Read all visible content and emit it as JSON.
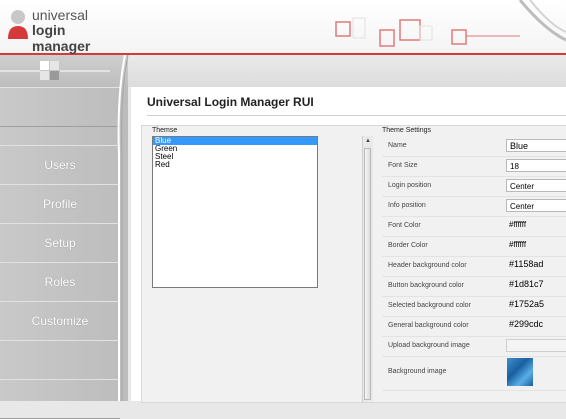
{
  "brand": {
    "line1": "universal",
    "line2": "login manager"
  },
  "sidebar": {
    "items": [
      {
        "label": ""
      },
      {
        "label": "Users"
      },
      {
        "label": "Profile"
      },
      {
        "label": "Setup"
      },
      {
        "label": "Roles"
      },
      {
        "label": "Customize"
      },
      {
        "label": ""
      },
      {
        "label": ""
      }
    ]
  },
  "page": {
    "title": "Universal Login Manager RUI"
  },
  "themes": {
    "caption": "Themse",
    "options": [
      "Blue",
      "Green",
      "Steel",
      "Red"
    ],
    "selected": "Blue"
  },
  "settings": {
    "caption": "Theme Settings",
    "rows": [
      {
        "label": "Name",
        "value": "Blue"
      },
      {
        "label": "Font Size",
        "value": "18"
      },
      {
        "label": "Login position",
        "value": "Center"
      },
      {
        "label": "Info position",
        "value": "Center"
      },
      {
        "label": "Font Color",
        "value": "#ffffff"
      },
      {
        "label": "Border Color",
        "value": "#ffffff"
      },
      {
        "label": "Header background color",
        "value": "#1158ad"
      },
      {
        "label": "Button background color",
        "value": "#1d81c7"
      },
      {
        "label": "Selected background color",
        "value": "#1752a5"
      },
      {
        "label": "General background color",
        "value": "#299cdc"
      },
      {
        "label": "Upload background image",
        "value": ""
      },
      {
        "label": "Background image",
        "value": ""
      }
    ]
  },
  "colors": {
    "accent": "#d43a3a",
    "selection": "#3399ff",
    "sidebar": "#c4c4c4"
  }
}
